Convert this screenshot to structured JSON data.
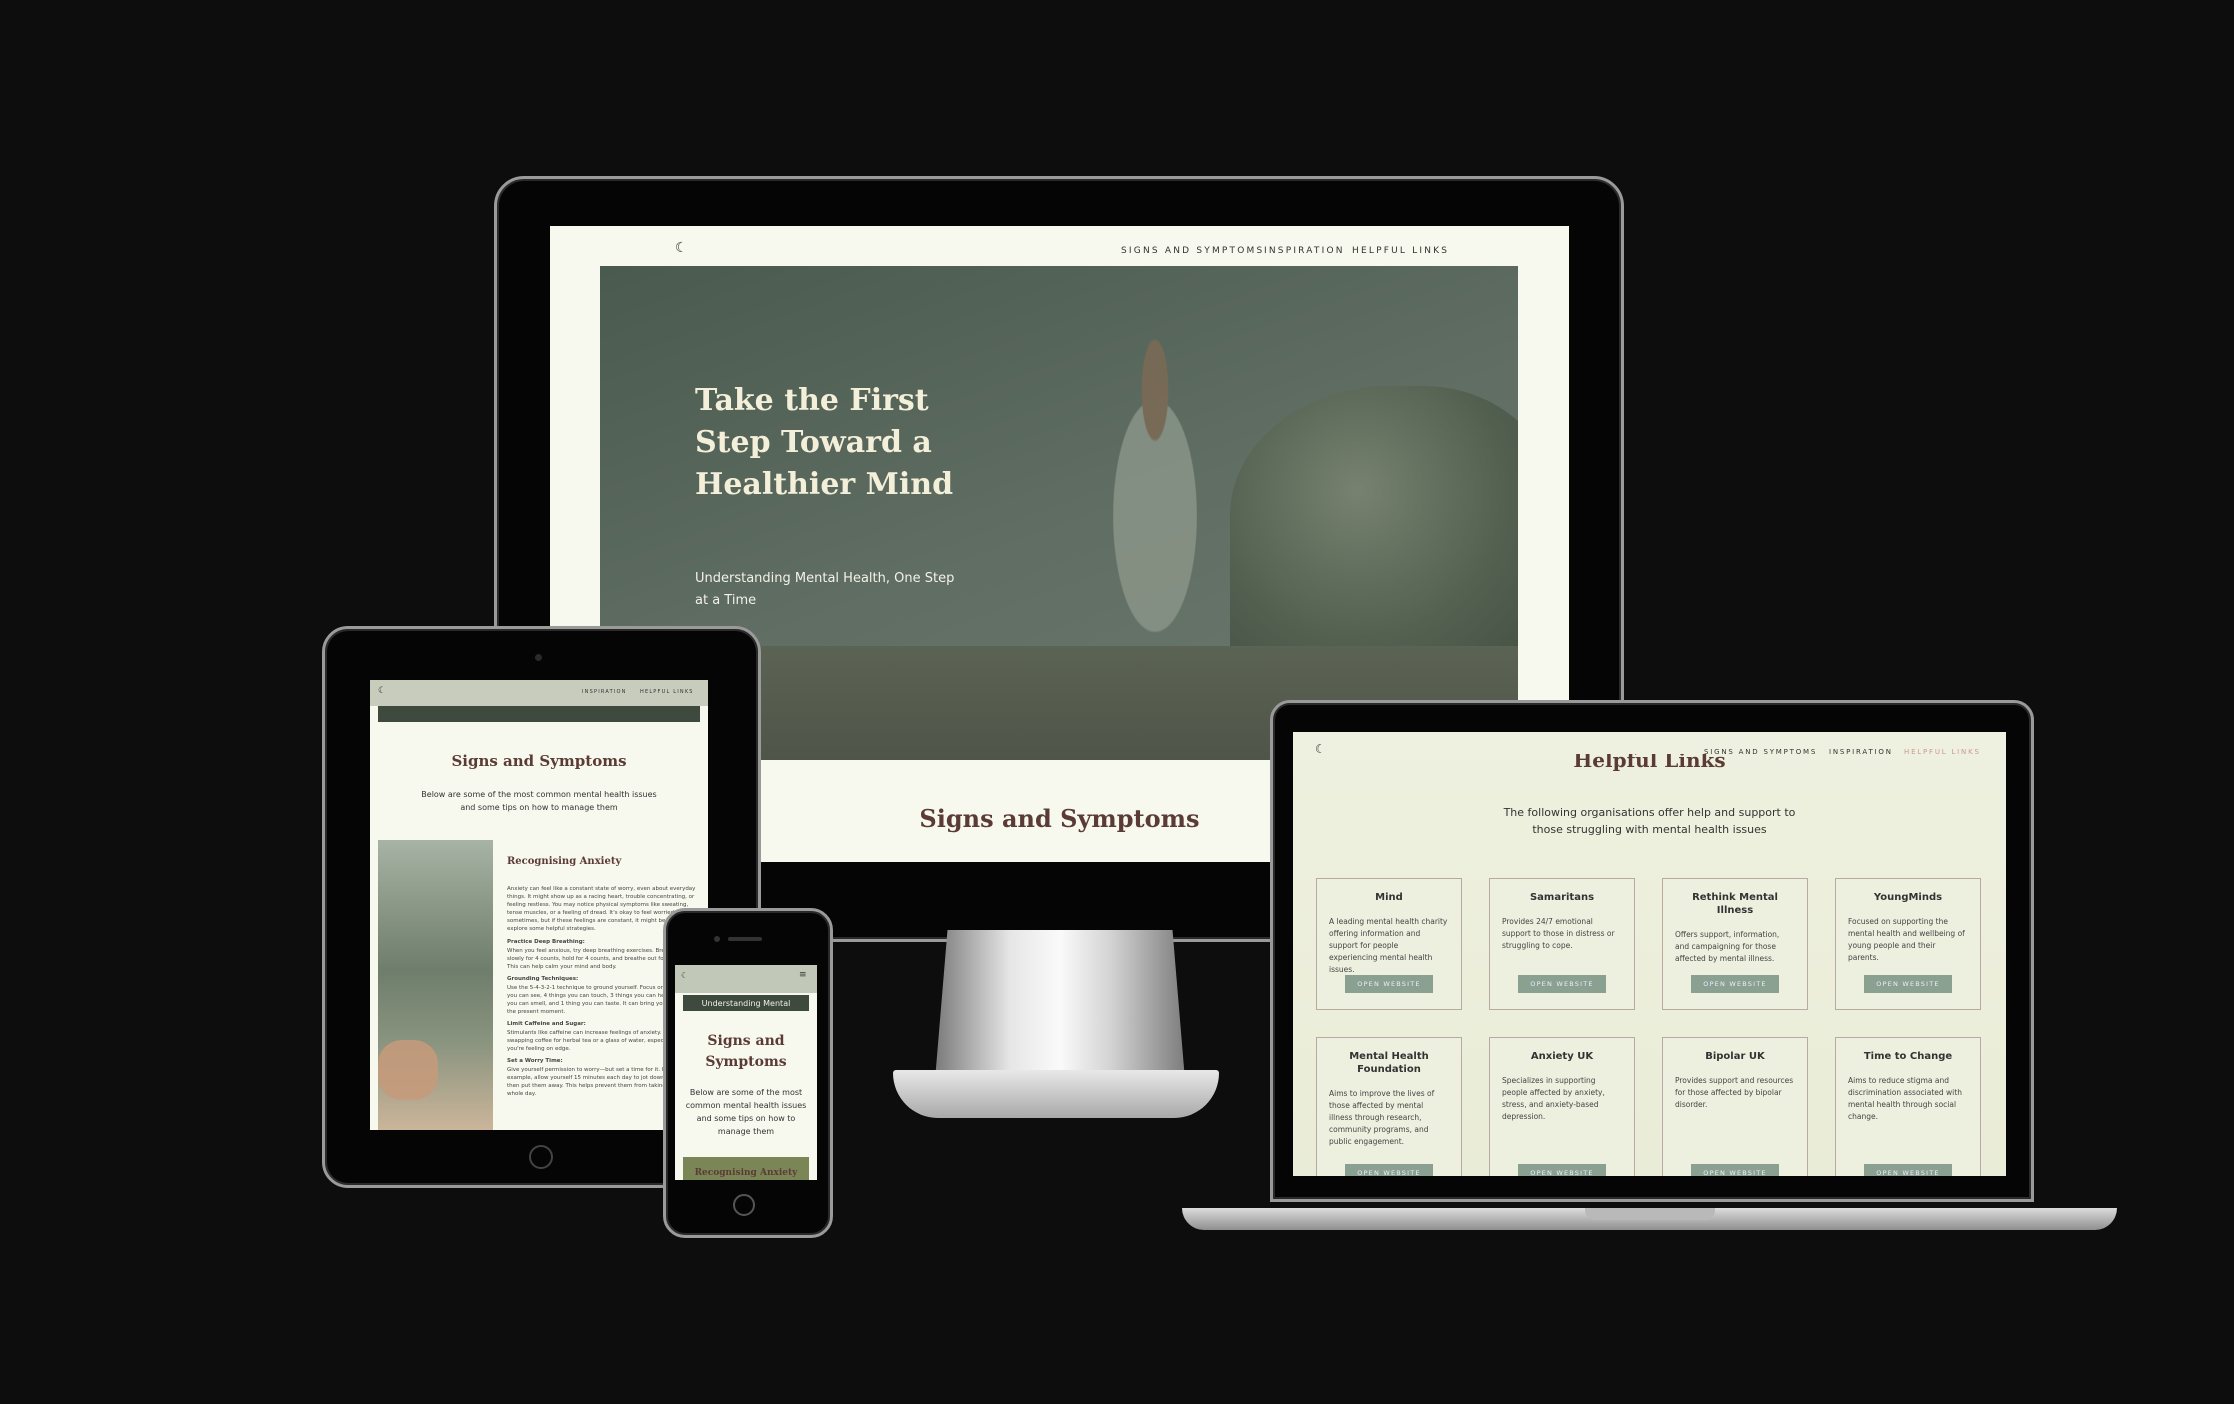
{
  "nav": {
    "moon_icon": "moon-icon",
    "links": [
      "SIGNS AND SYMPTOMS",
      "INSPIRATION",
      "HELPFUL LINKS"
    ]
  },
  "desktop": {
    "hero_title": "Take the First Step Toward a Healthier Mind",
    "hero_subtitle": "Understanding Mental Health, One Step at a Time",
    "section_title": "Signs and Symptoms"
  },
  "tablet": {
    "nav_links": [
      "INSPIRATION",
      "HELPFUL LINKS"
    ],
    "section_title": "Signs and Symptoms",
    "section_intro": "Below are some of the most common mental health issues and some tips on how to manage them",
    "card_title": "Recognising Anxiety",
    "card_intro": "Anxiety can feel like a constant state of worry, even about everyday things. It might show up as a racing heart, trouble concentrating, or feeling restless. You may notice physical symptoms like sweating, tense muscles, or a feeling of dread. It's okay to feel worried sometimes, but if these feelings are constant, it might be time to explore some helpful strategies.",
    "tips": [
      {
        "heading": "Practice Deep Breathing:",
        "text": "When you feel anxious, try deep breathing exercises. Breathe in slowly for 4 counts, hold for 4 counts, and breathe out for 4 counts. This can help calm your mind and body."
      },
      {
        "heading": "Grounding Techniques:",
        "text": "Use the 5-4-3-2-1 technique to ground yourself. Focus on 5 things you can see, 4 things you can touch, 3 things you can hear, 2 things you can smell, and 1 thing you can taste. It can bring you back to the present moment."
      },
      {
        "heading": "Limit Caffeine and Sugar:",
        "text": "Stimulants like caffeine can increase feelings of anxiety. Try swapping coffee for herbal tea or a glass of water, especially when you're feeling on edge."
      },
      {
        "heading": "Set a Worry Time:",
        "text": "Give yourself permission to worry—but set a time for it. For example, allow yourself 15 minutes each day to jot down worries, then put them away. This helps prevent them from taking over your whole day."
      }
    ]
  },
  "phone": {
    "banner": "Understanding Mental",
    "section_title": "Signs and Symptoms",
    "section_intro": "Below are some of the most common mental health issues and some tips on how to manage them",
    "card_title": "Recognising Anxiety"
  },
  "laptop": {
    "page_title": "Helpful Links",
    "intro": "The following organisations offer help and support to those struggling with mental health issues",
    "button_label": "OPEN WEBSITE",
    "cards": [
      {
        "title": "Mind",
        "desc": "A leading mental health charity offering information and support for people experiencing mental health issues."
      },
      {
        "title": "Samaritans",
        "desc": "Provides 24/7 emotional support to those in distress or struggling to cope."
      },
      {
        "title": "Rethink Mental Illness",
        "desc": "Offers support, information, and campaigning for those affected by mental illness."
      },
      {
        "title": "YoungMinds",
        "desc": "Focused on supporting the mental health and wellbeing of young people and their parents."
      },
      {
        "title": "Mental Health Foundation",
        "desc": "Aims to improve the lives of those affected by mental illness through research, community programs, and public engagement."
      },
      {
        "title": "Anxiety UK",
        "desc": "Specializes in supporting people affected by anxiety, stress, and anxiety-based depression."
      },
      {
        "title": "Bipolar UK",
        "desc": "Provides support and resources for those affected by bipolar disorder."
      },
      {
        "title": "Time to Change",
        "desc": "Aims to reduce stigma and discrimination associated with mental health through social change."
      }
    ]
  },
  "colors": {
    "accent_green": "#8aa090",
    "brand_brown": "#5b3b35",
    "cream": "#f7f8ee",
    "active_link": "#c99a8f"
  }
}
